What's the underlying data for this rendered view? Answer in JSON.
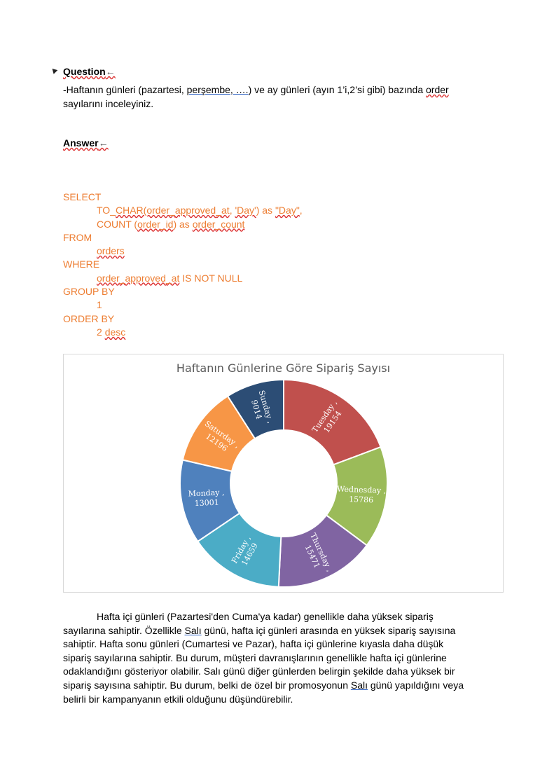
{
  "question": {
    "title": "Question",
    "tail_mark": "←",
    "text_before": "-Haftanın günleri (pazartesi, ",
    "text_link": "perşembe, ….",
    "text_after_1": ") ve ay günleri (ayın 1’i,2’si gibi) bazında ",
    "text_squiggle": "order",
    "text_line2": "sayılarını inceleyiniz."
  },
  "answer": {
    "title": "Answer",
    "tail_mark": "←"
  },
  "sql": {
    "select": "SELECT",
    "line_to": "TO",
    "line_char": "CHAR(order",
    "line_approved": "approved",
    "line_at": "at",
    "line_day1": "'Day'",
    "line_as": ") as ",
    "line_day2": "\"Day\"",
    "line_comma": ",",
    "count_prefix": "COUNT (",
    "count_order": "order",
    "count_id": "id",
    "count_as": ") as ",
    "count_alias": "order",
    "count_alias2": "count",
    "from": "FROM",
    "table": "orders",
    "where": "WHERE",
    "where_col": "order",
    "where_col2": "approved",
    "where_col3": "at",
    "where_tail": " IS NOT NULL",
    "group_by": "GROUP BY",
    "group_val": "1",
    "order_by": "ORDER BY",
    "order_val": "2 ",
    "order_desc": "desc"
  },
  "chart_data": {
    "type": "pie",
    "title": "Haftanın Günlerine Göre Sipariş Sayısı",
    "donut": true,
    "categories": [
      "Tuesday",
      "Wednesday",
      "Thursday",
      "Friday",
      "Monday",
      "Saturday",
      "Sunday"
    ],
    "values": [
      19154,
      15786,
      15471,
      14659,
      13001,
      12196,
      9014
    ],
    "colors": [
      "#c0504d",
      "#9bbb59",
      "#8064a2",
      "#4bacc6",
      "#4f81bd",
      "#f79646",
      "#2c4d75"
    ],
    "label_separator": ","
  },
  "body_text": {
    "line1": "Hafta içi günleri (Pazartesi'den Cuma'ya kadar) genellikle daha yüksek sipariş",
    "line2a": "sayılarına sahiptir. Özellikle ",
    "line2_link": "Salı",
    "line2b": " günü, hafta içi günleri arasında en yüksek sipariş sayısına",
    "line3": "sahiptir. Hafta sonu günleri (Cumartesi ve Pazar), hafta içi günlerine kıyasla daha düşük",
    "line4": "sipariş sayılarına sahiptir. Bu durum, müşteri davranışlarının genellikle hafta içi günlerine",
    "line5": "odaklandığını gösteriyor olabilir. Salı günü diğer günlerden belirgin şekilde daha yüksek bir",
    "line6a": "sipariş sayısına sahiptir. Bu durum, belki de özel bir promosyonun ",
    "line6_link": "Salı",
    "line6b": " günü yapıldığını veya",
    "line7": "belirli bir kampanyanın etkili olduğunu düşündürebilir."
  }
}
